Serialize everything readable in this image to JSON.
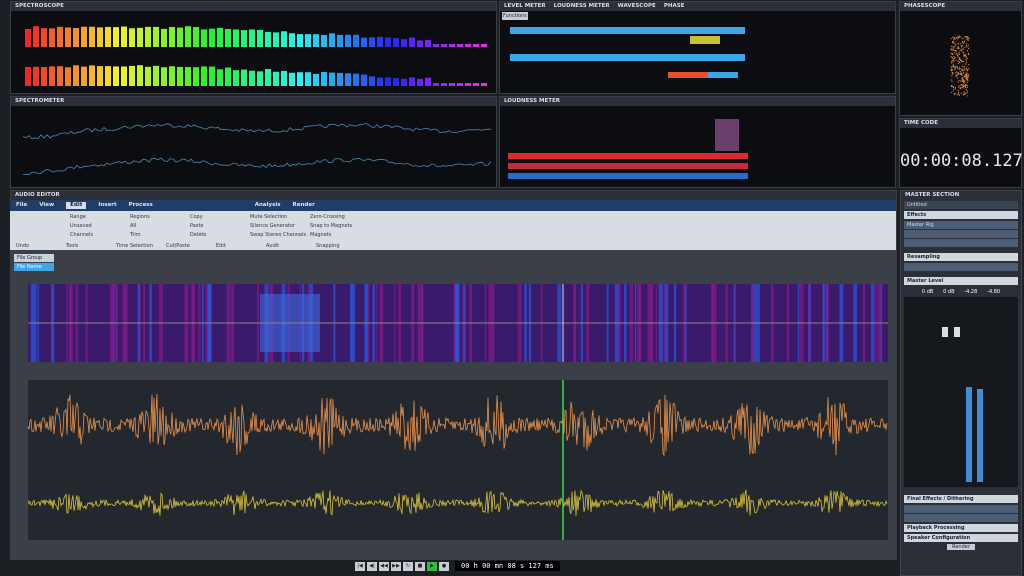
{
  "panels": {
    "spectroscope": "Spectroscope",
    "level_meter_tabs": [
      "Level Meter",
      "Loudness Meter",
      "Wavescope",
      "Phase"
    ],
    "phasescope": "Phasescope",
    "spectrometer": "Spectrometer",
    "loudness_meter": "Loudness Meter",
    "time_code": "Time Code",
    "time_code_value": "00:00:08.127",
    "functions_label": "Functions"
  },
  "editor": {
    "title": "Audio Editor",
    "tabs": [
      "File",
      "View",
      "Edit",
      "Insert",
      "Process",
      "Analysis",
      "Render"
    ],
    "ribbon": [
      "Range",
      "Unsaved",
      "Channels",
      "Regions",
      "All",
      "Trim",
      "Copy",
      "Paste",
      "Delete",
      "Mute Selection",
      "Silence Generator",
      "Swap Stereo Channels",
      "Zero-Crossing",
      "Snap to Magnets",
      "Magnets"
    ],
    "groups": [
      "Undo",
      "Tools",
      "Time Selection",
      "Cut/Paste",
      "Edit",
      "Audit",
      "Snapping"
    ],
    "file_tab": "File Group",
    "file_name": "File Name"
  },
  "master": {
    "title": "Master Section",
    "preset": "Untitled",
    "effects": "Effects",
    "slot1": "Master Rig",
    "resampling": "Resampling",
    "master_level": "Master Level",
    "levels": [
      "0 dB",
      "0 dB",
      "-4.28",
      "-4.80"
    ],
    "final": "Final Effects / Dithering",
    "playback": "Playback Processing",
    "speaker": "Speaker Configuration",
    "render": "Render"
  },
  "transport": {
    "time": "00 h 00 mn 08 s 127 ms"
  },
  "colors": {
    "wave_top": "#e8924a",
    "wave_bottom": "#d8c23a",
    "cursor": "#37e04a",
    "accent": "#1f3d66"
  }
}
